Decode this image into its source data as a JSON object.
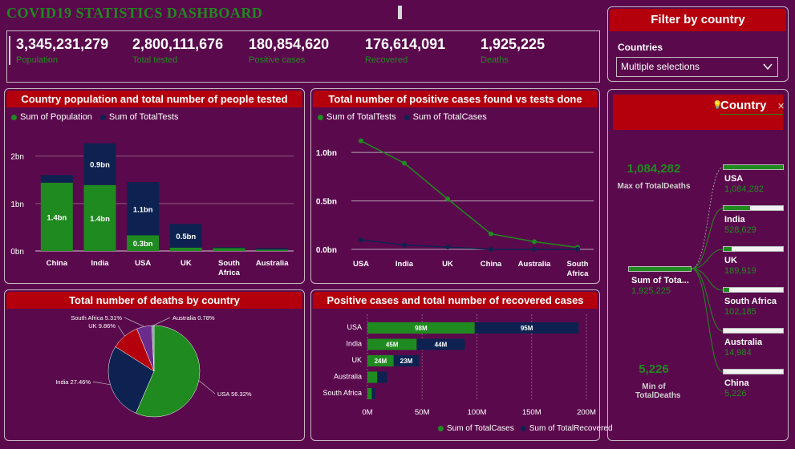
{
  "header": {
    "title": "COVID19  STATISTICS  DASHBOARD"
  },
  "kpis": [
    {
      "value": "3,345,231,279",
      "label": "Population"
    },
    {
      "value": "2,800,111,676",
      "label": "Total tested"
    },
    {
      "value": "180,854,620",
      "label": "Positive cases"
    },
    {
      "value": "176,614,091",
      "label": "Recovered"
    },
    {
      "value": "1,925,225",
      "label": "Deaths"
    }
  ],
  "filter": {
    "title": "Filter by country",
    "label": "Countries",
    "selected": "Multiple selections",
    "icon": "chevron-down-icon"
  },
  "colors": {
    "green": "#1f8a1f",
    "navy": "#0d2250",
    "red": "#b3000c",
    "purple": "#6b2b8c",
    "bg": "#5a0a4c"
  },
  "charts": [
    {
      "type": "bar",
      "stacked": true,
      "title": "Country population  and total number of people tested",
      "categories": [
        "China",
        "India",
        "USA",
        "UK",
        "South Africa",
        "Australia"
      ],
      "series": [
        {
          "name": "Sum of Population",
          "values": [
            1.44,
            1.39,
            0.33,
            0.07,
            0.06,
            0.03
          ]
        },
        {
          "name": "Sum of TotalTests",
          "values": [
            0.16,
            0.88,
            1.12,
            0.5,
            0.02,
            0.03
          ]
        }
      ],
      "data_labels": [
        {
          "series": 0,
          "index": 0,
          "text": "1.4bn"
        },
        {
          "series": 0,
          "index": 1,
          "text": "1.4bn"
        },
        {
          "series": 0,
          "index": 2,
          "text": "0.3bn"
        },
        {
          "series": 1,
          "index": 1,
          "text": "0.9bn"
        },
        {
          "series": 1,
          "index": 2,
          "text": "1.1bn"
        },
        {
          "series": 1,
          "index": 3,
          "text": "0.5bn"
        }
      ],
      "yticks": [
        "0bn",
        "1bn",
        "2bn"
      ],
      "ylim": [
        0,
        2.4
      ],
      "legend": "top-left"
    },
    {
      "type": "line",
      "title": "Total number of positive cases found vs tests done",
      "categories": [
        "USA",
        "India",
        "UK",
        "China",
        "Australia",
        "South Africa"
      ],
      "series": [
        {
          "name": "Sum of TotalTests",
          "values": [
            1.12,
            0.89,
            0.52,
            0.16,
            0.08,
            0.02
          ]
        },
        {
          "name": "Sum of TotalCases",
          "values": [
            0.098,
            0.045,
            0.024,
            0.0001,
            3e-05,
            0.002
          ]
        }
      ],
      "yticks": [
        "0.0bn",
        "0.5bn",
        "1.0bn"
      ],
      "ylim": [
        0,
        1.2
      ],
      "legend": "top-left"
    },
    {
      "type": "pie",
      "title": "Total number of deaths  by country",
      "categories": [
        "USA",
        "India",
        "UK",
        "South Africa",
        "Australia"
      ],
      "values": [
        56.32,
        27.46,
        9.86,
        5.31,
        0.78
      ],
      "labels": [
        "USA 56.32%",
        "India 27.46%",
        "UK 9.86%",
        "South Africa 5.31%",
        "Australia 0.78%"
      ]
    },
    {
      "type": "bar",
      "orientation": "horizontal",
      "stacked": true,
      "title": "Positive cases and total number of recovered cases",
      "categories": [
        "USA",
        "India",
        "UK",
        "Australia",
        "South Africa"
      ],
      "series": [
        {
          "name": "Sum of TotalCases",
          "values": [
            98,
            45,
            24,
            9,
            4
          ]
        },
        {
          "name": "Sum of TotalRecovered",
          "values": [
            95,
            44,
            23,
            9,
            3
          ]
        }
      ],
      "data_labels": [
        {
          "series": 0,
          "index": 0,
          "text": "98M"
        },
        {
          "series": 1,
          "index": 0,
          "text": "95M"
        },
        {
          "series": 0,
          "index": 1,
          "text": "45M"
        },
        {
          "series": 1,
          "index": 1,
          "text": "44M"
        },
        {
          "series": 0,
          "index": 2,
          "text": "24M"
        },
        {
          "series": 1,
          "index": 2,
          "text": "23M"
        }
      ],
      "xticks": [
        "0M",
        "50M",
        "100M",
        "150M",
        "200M"
      ],
      "xlim": [
        0,
        200
      ],
      "legend": "bottom-right"
    }
  ],
  "tree": {
    "title": "Country",
    "root": {
      "name": "Sum of Tota...",
      "value": "1,925,225"
    },
    "max": {
      "value": "1,084,282",
      "label": "Max of TotalDeaths"
    },
    "min": {
      "value": "5,226",
      "label": "Min of TotalDeaths"
    },
    "nodes": [
      {
        "name": "USA",
        "value": "1,084,282",
        "fraction": 1.0
      },
      {
        "name": "India",
        "value": "528,629",
        "fraction": 0.44
      },
      {
        "name": "UK",
        "value": "189,919",
        "fraction": 0.14
      },
      {
        "name": "South Africa",
        "value": "102,185",
        "fraction": 0.09
      },
      {
        "name": "Australia",
        "value": "14,984",
        "fraction": 0.0
      },
      {
        "name": "China",
        "value": "5,226",
        "fraction": 0.0
      }
    ]
  }
}
